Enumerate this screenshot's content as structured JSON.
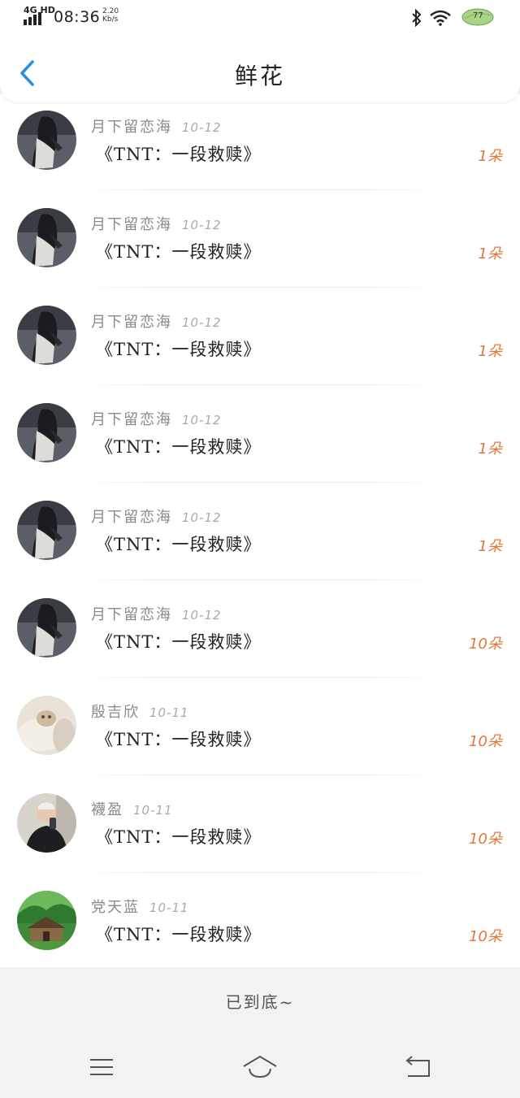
{
  "status_bar": {
    "network": "4G HD",
    "time": "08:36",
    "speed_value": "2.20",
    "speed_unit": "Kb/s",
    "battery": "77",
    "icons": [
      "signal-icon",
      "bluetooth-icon",
      "wifi-icon",
      "battery-icon"
    ]
  },
  "header": {
    "title": "鲜花",
    "back_icon": "chevron-left-icon",
    "accent_color": "#2a8fe0"
  },
  "items": [
    {
      "name": "月下留恋海",
      "date": "10-12",
      "work": "《TNT：一段救赎》",
      "count": "1朵",
      "avatar": "dark-portrait"
    },
    {
      "name": "月下留恋海",
      "date": "10-12",
      "work": "《TNT：一段救赎》",
      "count": "1朵",
      "avatar": "dark-portrait"
    },
    {
      "name": "月下留恋海",
      "date": "10-12",
      "work": "《TNT：一段救赎》",
      "count": "1朵",
      "avatar": "dark-portrait"
    },
    {
      "name": "月下留恋海",
      "date": "10-12",
      "work": "《TNT：一段救赎》",
      "count": "1朵",
      "avatar": "dark-portrait"
    },
    {
      "name": "月下留恋海",
      "date": "10-12",
      "work": "《TNT：一段救赎》",
      "count": "1朵",
      "avatar": "dark-portrait"
    },
    {
      "name": "月下留恋海",
      "date": "10-12",
      "work": "《TNT：一段救赎》",
      "count": "10朵",
      "avatar": "dark-portrait"
    },
    {
      "name": "殷吉欣",
      "date": "10-11",
      "work": "《TNT：一段救赎》",
      "count": "10朵",
      "avatar": "plush-toy"
    },
    {
      "name": "襪盈",
      "date": "10-11",
      "work": "《TNT：一段救赎》",
      "count": "10朵",
      "avatar": "selfie-person"
    },
    {
      "name": "党天蓝",
      "date": "10-11",
      "work": "《TNT：一段救赎》",
      "count": "10朵",
      "avatar": "green-cabin"
    }
  ],
  "count_color": "#e0783a",
  "footer": {
    "end_text": "已到底~"
  },
  "navbar": {
    "icons": [
      "menu-icon",
      "home-icon",
      "back-icon"
    ]
  }
}
